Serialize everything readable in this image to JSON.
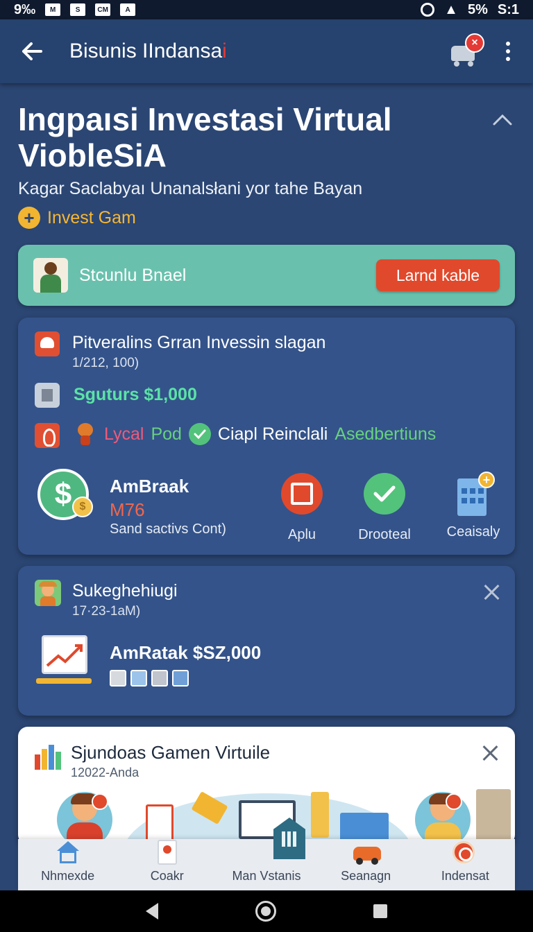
{
  "status_bar": {
    "left_text": "9‰",
    "left_icons": [
      "M",
      "S",
      "CM",
      "A"
    ],
    "right_text": "5%",
    "time": "S:1"
  },
  "app_bar": {
    "title_main": "Bisunis IIndansa",
    "title_accent": "i",
    "cart_badge": "×"
  },
  "hero": {
    "title": "Ingpaısi Investasi Virtual ViobleSiA",
    "subtitle": "Kagar Saclabyaı Unanalsłani yor tahe Bayan",
    "invest_link": "Invest Gam"
  },
  "banner": {
    "text": "Stcunlu Bnael",
    "button": "Larnd kable"
  },
  "card1": {
    "title": "Pitveralins Grran Invessin slagan",
    "date": "1/212, 100)",
    "status": "Sguturs $1,000",
    "tag1": "Lycal",
    "tag2": "Pod",
    "tag3": "Ciapl Reinclali",
    "tag4": "Asedbertiuns",
    "name": "AmBraak",
    "amount": "M76",
    "note": "Sand sactivs Cont)",
    "actions": [
      {
        "label": "Aplu",
        "icon": "frame-icon"
      },
      {
        "label": "Drooteal",
        "icon": "check-icon"
      },
      {
        "label": "Ceaisaly",
        "icon": "building-icon"
      }
    ]
  },
  "card2": {
    "title": "Sukeghehiugi",
    "date": "17·23-1aM)",
    "amount": "AmRatak $SZ,000"
  },
  "card3": {
    "title": "Sjundoas Gamen Virtuile",
    "date": "12022-Anda"
  },
  "bottom_nav": [
    {
      "label": "Nhmexde",
      "icon": "home-icon"
    },
    {
      "label": "Coakr",
      "icon": "badge-icon"
    },
    {
      "label": "Man Vstanis",
      "icon": "grid-icon"
    },
    {
      "label": "Seanagn",
      "icon": "car-icon"
    },
    {
      "label": "Indensat",
      "icon": "cookie-icon"
    }
  ],
  "colors": {
    "background": "#2b4673",
    "card": "#34538a",
    "banner": "#69c1ad",
    "accent_red": "#e0492c",
    "accent_green": "#53c37b",
    "accent_gold": "#f2b531"
  }
}
